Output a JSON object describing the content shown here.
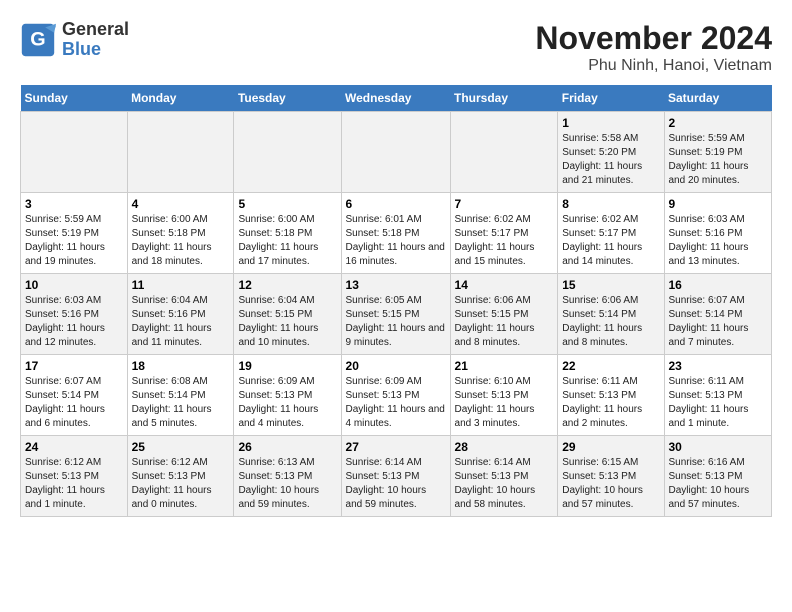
{
  "logo": {
    "general": "General",
    "blue": "Blue"
  },
  "title": "November 2024",
  "subtitle": "Phu Ninh, Hanoi, Vietnam",
  "days_of_week": [
    "Sunday",
    "Monday",
    "Tuesday",
    "Wednesday",
    "Thursday",
    "Friday",
    "Saturday"
  ],
  "weeks": [
    [
      {
        "day": "",
        "info": ""
      },
      {
        "day": "",
        "info": ""
      },
      {
        "day": "",
        "info": ""
      },
      {
        "day": "",
        "info": ""
      },
      {
        "day": "",
        "info": ""
      },
      {
        "day": "1",
        "info": "Sunrise: 5:58 AM\nSunset: 5:20 PM\nDaylight: 11 hours and 21 minutes."
      },
      {
        "day": "2",
        "info": "Sunrise: 5:59 AM\nSunset: 5:19 PM\nDaylight: 11 hours and 20 minutes."
      }
    ],
    [
      {
        "day": "3",
        "info": "Sunrise: 5:59 AM\nSunset: 5:19 PM\nDaylight: 11 hours and 19 minutes."
      },
      {
        "day": "4",
        "info": "Sunrise: 6:00 AM\nSunset: 5:18 PM\nDaylight: 11 hours and 18 minutes."
      },
      {
        "day": "5",
        "info": "Sunrise: 6:00 AM\nSunset: 5:18 PM\nDaylight: 11 hours and 17 minutes."
      },
      {
        "day": "6",
        "info": "Sunrise: 6:01 AM\nSunset: 5:18 PM\nDaylight: 11 hours and 16 minutes."
      },
      {
        "day": "7",
        "info": "Sunrise: 6:02 AM\nSunset: 5:17 PM\nDaylight: 11 hours and 15 minutes."
      },
      {
        "day": "8",
        "info": "Sunrise: 6:02 AM\nSunset: 5:17 PM\nDaylight: 11 hours and 14 minutes."
      },
      {
        "day": "9",
        "info": "Sunrise: 6:03 AM\nSunset: 5:16 PM\nDaylight: 11 hours and 13 minutes."
      }
    ],
    [
      {
        "day": "10",
        "info": "Sunrise: 6:03 AM\nSunset: 5:16 PM\nDaylight: 11 hours and 12 minutes."
      },
      {
        "day": "11",
        "info": "Sunrise: 6:04 AM\nSunset: 5:16 PM\nDaylight: 11 hours and 11 minutes."
      },
      {
        "day": "12",
        "info": "Sunrise: 6:04 AM\nSunset: 5:15 PM\nDaylight: 11 hours and 10 minutes."
      },
      {
        "day": "13",
        "info": "Sunrise: 6:05 AM\nSunset: 5:15 PM\nDaylight: 11 hours and 9 minutes."
      },
      {
        "day": "14",
        "info": "Sunrise: 6:06 AM\nSunset: 5:15 PM\nDaylight: 11 hours and 8 minutes."
      },
      {
        "day": "15",
        "info": "Sunrise: 6:06 AM\nSunset: 5:14 PM\nDaylight: 11 hours and 8 minutes."
      },
      {
        "day": "16",
        "info": "Sunrise: 6:07 AM\nSunset: 5:14 PM\nDaylight: 11 hours and 7 minutes."
      }
    ],
    [
      {
        "day": "17",
        "info": "Sunrise: 6:07 AM\nSunset: 5:14 PM\nDaylight: 11 hours and 6 minutes."
      },
      {
        "day": "18",
        "info": "Sunrise: 6:08 AM\nSunset: 5:14 PM\nDaylight: 11 hours and 5 minutes."
      },
      {
        "day": "19",
        "info": "Sunrise: 6:09 AM\nSunset: 5:13 PM\nDaylight: 11 hours and 4 minutes."
      },
      {
        "day": "20",
        "info": "Sunrise: 6:09 AM\nSunset: 5:13 PM\nDaylight: 11 hours and 4 minutes."
      },
      {
        "day": "21",
        "info": "Sunrise: 6:10 AM\nSunset: 5:13 PM\nDaylight: 11 hours and 3 minutes."
      },
      {
        "day": "22",
        "info": "Sunrise: 6:11 AM\nSunset: 5:13 PM\nDaylight: 11 hours and 2 minutes."
      },
      {
        "day": "23",
        "info": "Sunrise: 6:11 AM\nSunset: 5:13 PM\nDaylight: 11 hours and 1 minute."
      }
    ],
    [
      {
        "day": "24",
        "info": "Sunrise: 6:12 AM\nSunset: 5:13 PM\nDaylight: 11 hours and 1 minute."
      },
      {
        "day": "25",
        "info": "Sunrise: 6:12 AM\nSunset: 5:13 PM\nDaylight: 11 hours and 0 minutes."
      },
      {
        "day": "26",
        "info": "Sunrise: 6:13 AM\nSunset: 5:13 PM\nDaylight: 10 hours and 59 minutes."
      },
      {
        "day": "27",
        "info": "Sunrise: 6:14 AM\nSunset: 5:13 PM\nDaylight: 10 hours and 59 minutes."
      },
      {
        "day": "28",
        "info": "Sunrise: 6:14 AM\nSunset: 5:13 PM\nDaylight: 10 hours and 58 minutes."
      },
      {
        "day": "29",
        "info": "Sunrise: 6:15 AM\nSunset: 5:13 PM\nDaylight: 10 hours and 57 minutes."
      },
      {
        "day": "30",
        "info": "Sunrise: 6:16 AM\nSunset: 5:13 PM\nDaylight: 10 hours and 57 minutes."
      }
    ]
  ]
}
